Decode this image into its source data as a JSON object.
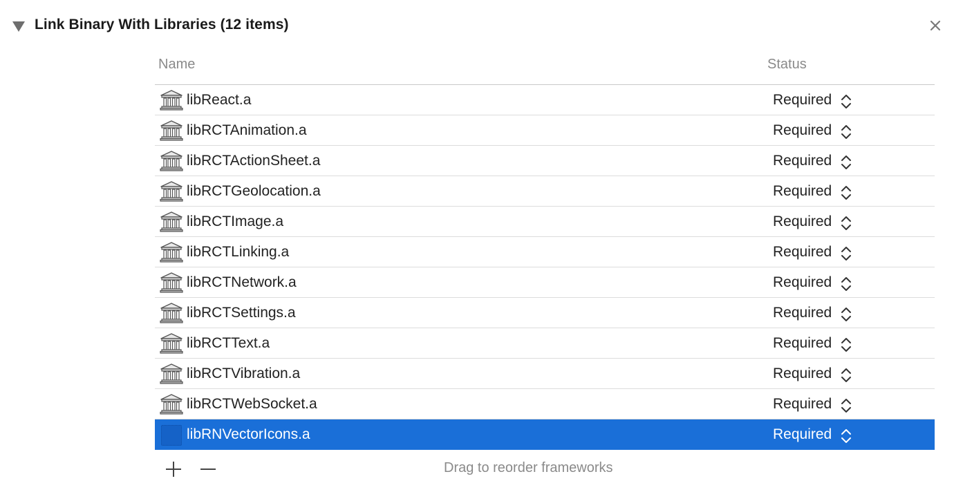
{
  "section": {
    "title": "Link Binary With Libraries (12 items)"
  },
  "table": {
    "columns": {
      "name": "Name",
      "status": "Status"
    },
    "rows": [
      {
        "name": "libReact.a",
        "status": "Required",
        "selected": false
      },
      {
        "name": "libRCTAnimation.a",
        "status": "Required",
        "selected": false
      },
      {
        "name": "libRCTActionSheet.a",
        "status": "Required",
        "selected": false
      },
      {
        "name": "libRCTGeolocation.a",
        "status": "Required",
        "selected": false
      },
      {
        "name": "libRCTImage.a",
        "status": "Required",
        "selected": false
      },
      {
        "name": "libRCTLinking.a",
        "status": "Required",
        "selected": false
      },
      {
        "name": "libRCTNetwork.a",
        "status": "Required",
        "selected": false
      },
      {
        "name": "libRCTSettings.a",
        "status": "Required",
        "selected": false
      },
      {
        "name": "libRCTText.a",
        "status": "Required",
        "selected": false
      },
      {
        "name": "libRCTVibration.a",
        "status": "Required",
        "selected": false
      },
      {
        "name": "libRCTWebSocket.a",
        "status": "Required",
        "selected": false
      },
      {
        "name": "libRNVectorIcons.a",
        "status": "Required",
        "selected": true
      }
    ]
  },
  "footer": {
    "hint": "Drag to reorder frameworks"
  },
  "icons": {
    "disclosure": "disclosure-triangle-icon",
    "close": "close-icon",
    "library": "library-icon",
    "stepper": "up-down-chevron-icon",
    "add": "plus-icon",
    "remove": "minus-icon"
  },
  "colors": {
    "selection": "#1a6fd8",
    "header_text": "#8a8a8a"
  }
}
